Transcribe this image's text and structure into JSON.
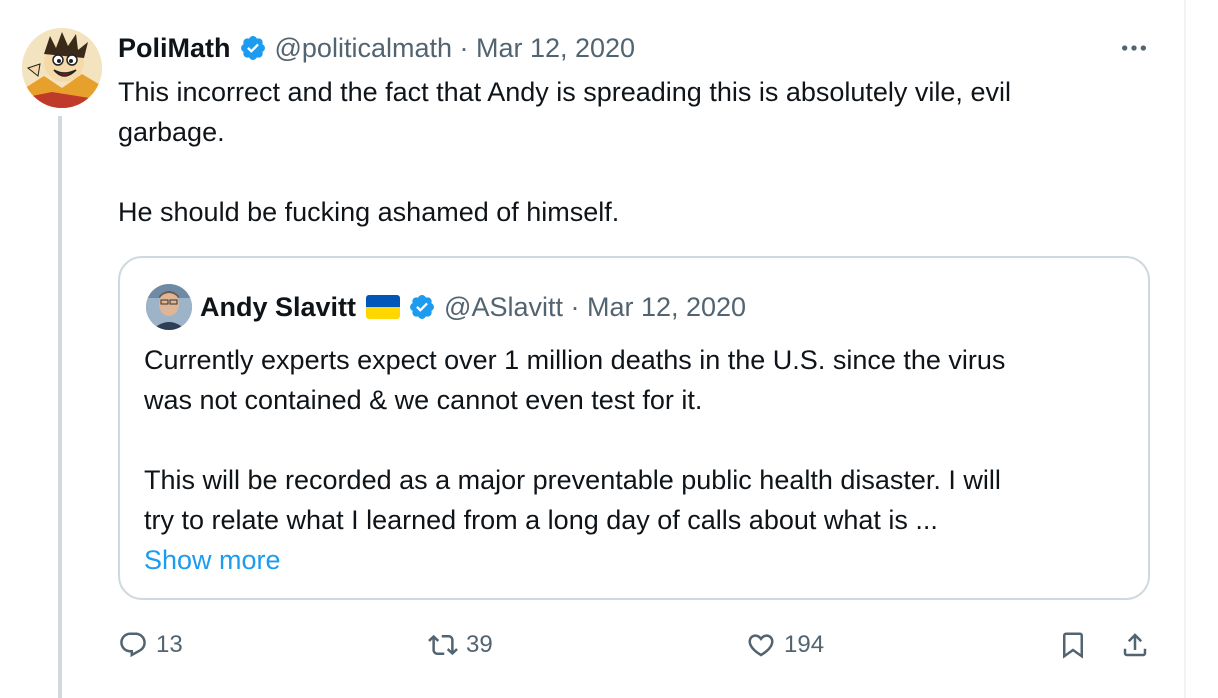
{
  "tweet": {
    "author_name": "PoliMath",
    "handle_date": "@politicalmath · Mar 12, 2020",
    "text": "This incorrect and the fact that Andy is spreading this is absolutely vile, evil\ngarbage.\n\nHe should be fucking ashamed of himself."
  },
  "quote": {
    "author_name": "Andy Slavitt",
    "handle_date": "@ASlavitt · Mar 12, 2020",
    "text": "Currently experts expect over 1 million deaths in the U.S. since the virus\nwas not contained & we cannot even test for it.\n\nThis will be recorded as a major preventable public health disaster. I will\ntry to relate what I learned from a long day of calls about what is ...",
    "show_more": "Show more"
  },
  "actions": {
    "replies": "13",
    "retweets": "39",
    "likes": "194"
  },
  "colors": {
    "verified": "#1d9bf0",
    "link": "#1d9bf0",
    "muted": "#536471",
    "border": "#cfd9de"
  },
  "icons": [
    "verified-badge-icon",
    "more-icon",
    "reply-icon",
    "retweet-icon",
    "like-icon",
    "bookmark-icon",
    "share-icon",
    "ukraine-flag-icon"
  ]
}
